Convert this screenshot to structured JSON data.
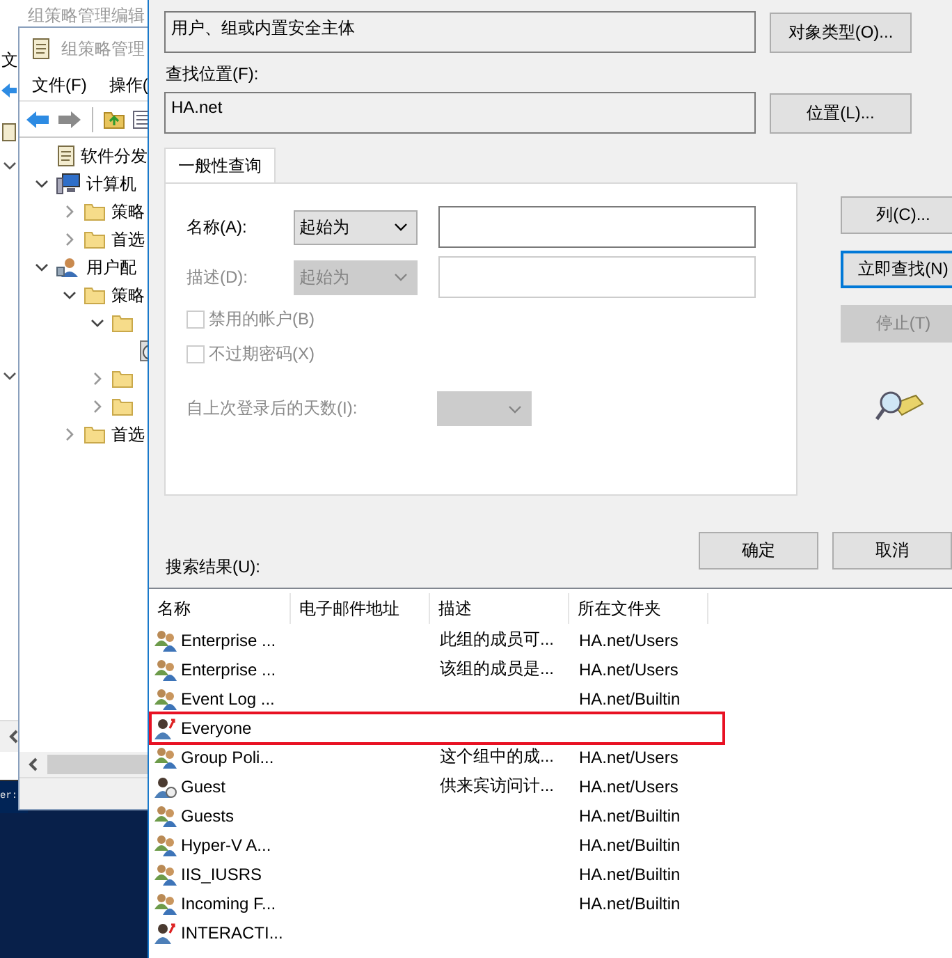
{
  "back_window": {
    "title": "组策略管理编辑",
    "menu": "文"
  },
  "console": {
    "text": "er:"
  },
  "editor_window": {
    "title": "组策略管理",
    "menus": [
      "文件(F)",
      "操作("
    ],
    "tree": [
      {
        "label": "软件分发",
        "kind": "policy",
        "children": [
          {
            "label": "计算机",
            "kind": "computer",
            "expanded": true,
            "children": [
              {
                "label": "策略",
                "kind": "folder",
                "expanded": false
              },
              {
                "label": "首选",
                "kind": "folder",
                "expanded": false
              }
            ]
          },
          {
            "label": "用户配",
            "kind": "user",
            "expanded": true,
            "children": [
              {
                "label": "策略",
                "kind": "folder",
                "expanded": true,
                "children": [
                  {
                    "kind": "folder",
                    "expanded": true,
                    "children": [
                      {
                        "kind": "disk"
                      }
                    ]
                  },
                  {
                    "kind": "folder",
                    "expanded": false
                  },
                  {
                    "kind": "folder",
                    "expanded": false
                  }
                ]
              },
              {
                "label": "首选",
                "kind": "folder",
                "expanded": false
              }
            ]
          }
        ]
      }
    ]
  },
  "dialog": {
    "object_type": {
      "value": "用户、组或内置安全主体",
      "button": "对象类型(O)..."
    },
    "location_label": "查找位置(F):",
    "location": {
      "value": "HA.net",
      "button": "位置(L)..."
    },
    "tabs": [
      {
        "label": "一般性查询",
        "selected": true
      }
    ],
    "query_rows": [
      {
        "label": "名称(A):",
        "operator": "起始为",
        "disabled": false
      },
      {
        "label": "描述(D):",
        "operator": "起始为",
        "disabled": true
      }
    ],
    "checkboxes": [
      {
        "label": "禁用的帐户(B)",
        "checked": false,
        "disabled": true
      },
      {
        "label": "不过期密码(X)",
        "checked": false,
        "disabled": true
      }
    ],
    "days": {
      "label": "自上次登录后的天数(I):",
      "disabled": true
    },
    "side_buttons": [
      {
        "label": "列(C)...",
        "default": false,
        "disabled": false
      },
      {
        "label": "立即查找(N)",
        "default": true,
        "disabled": false
      },
      {
        "label": "停止(T)",
        "default": false,
        "disabled": true
      }
    ],
    "ok_button": "确定",
    "cancel_button": "取消",
    "results_label": "搜索结果(U):",
    "results": {
      "columns": [
        "名称",
        "电子邮件地址",
        "描述",
        "所在文件夹"
      ],
      "rows": [
        {
          "kind": "group",
          "name": "Enterprise ...",
          "description": "此组的成员可...",
          "folder": "HA.net/Users",
          "highlighted": false
        },
        {
          "kind": "group",
          "name": "Enterprise ...",
          "description": "该组的成员是...",
          "folder": "HA.net/Users",
          "highlighted": false
        },
        {
          "kind": "group",
          "name": "Event Log ...",
          "folder": "HA.net/Builtin",
          "highlighted": false
        },
        {
          "kind": "principal",
          "name": "Everyone",
          "highlighted": true
        },
        {
          "kind": "group",
          "name": "Group Poli...",
          "description": "这个组中的成...",
          "folder": "HA.net/Users",
          "highlighted": false
        },
        {
          "kind": "user",
          "name": "Guest",
          "description": "供来宾访问计...",
          "folder": "HA.net/Users",
          "highlighted": false
        },
        {
          "kind": "group",
          "name": "Guests",
          "folder": "HA.net/Builtin",
          "highlighted": false
        },
        {
          "kind": "group",
          "name": "Hyper-V A...",
          "folder": "HA.net/Builtin",
          "highlighted": false
        },
        {
          "kind": "group",
          "name": "IIS_IUSRS",
          "folder": "HA.net/Builtin",
          "highlighted": false
        },
        {
          "kind": "group",
          "name": "Incoming F...",
          "folder": "HA.net/Builtin",
          "highlighted": false
        },
        {
          "kind": "principal",
          "name": "INTERACTI...",
          "highlighted": false
        }
      ]
    }
  }
}
